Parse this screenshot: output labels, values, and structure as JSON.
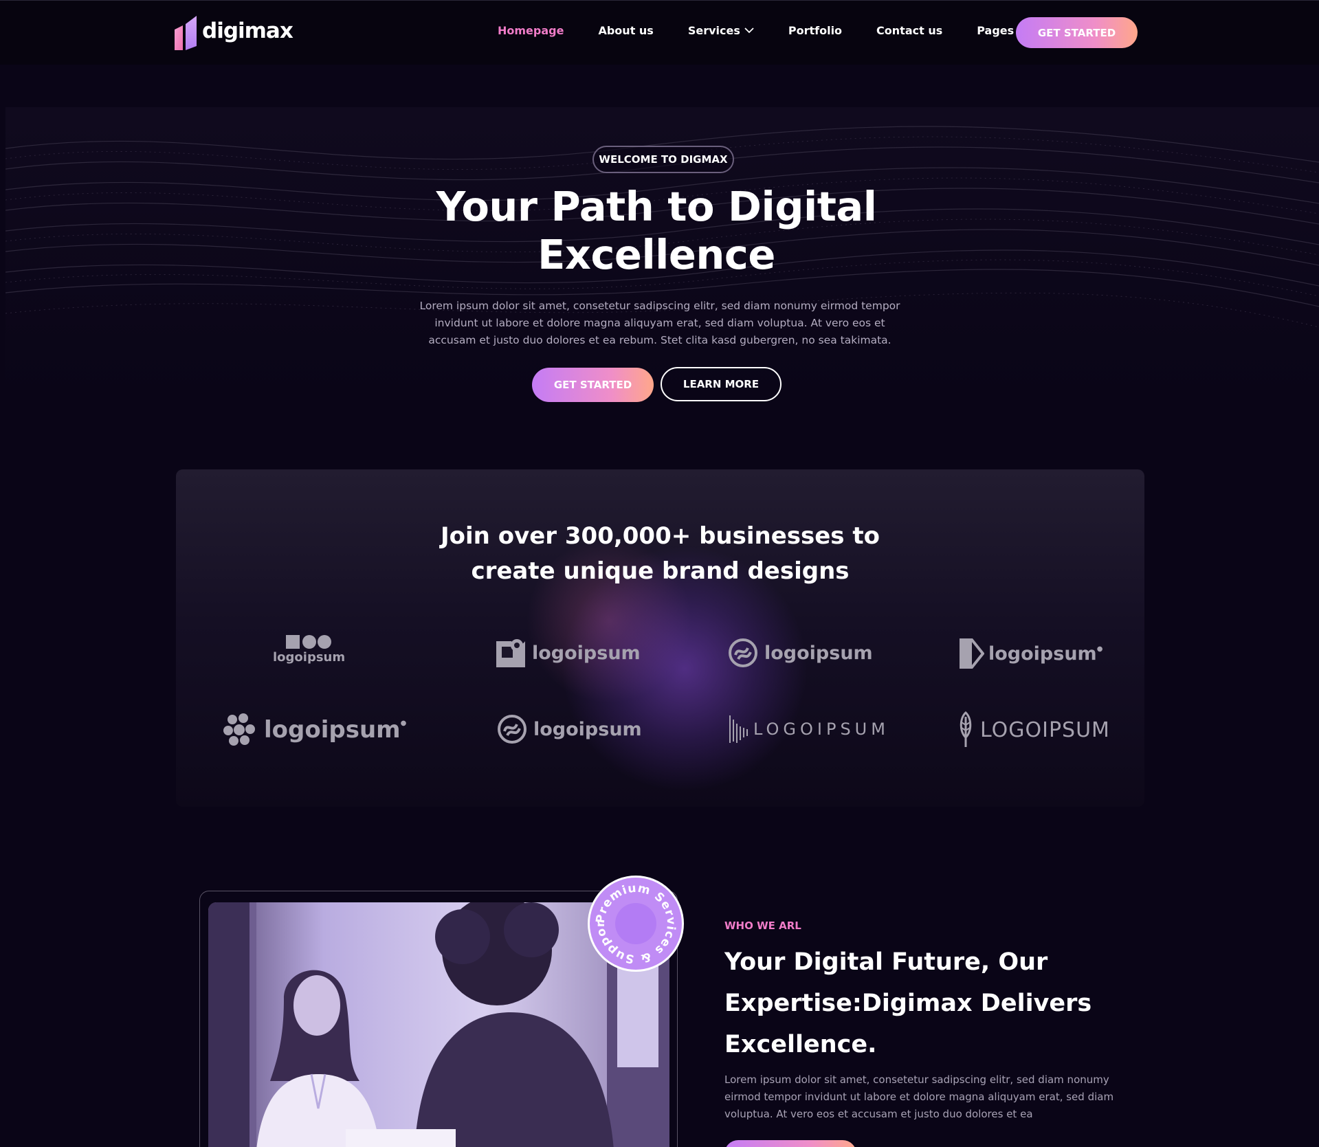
{
  "brand": {
    "name": "digimax"
  },
  "nav": {
    "links": [
      {
        "label": "Homepage",
        "active": true,
        "dropdown": false
      },
      {
        "label": "About us",
        "active": false,
        "dropdown": false
      },
      {
        "label": "Services",
        "active": false,
        "dropdown": true
      },
      {
        "label": "Portfolio",
        "active": false,
        "dropdown": false
      },
      {
        "label": "Contact us",
        "active": false,
        "dropdown": false
      },
      {
        "label": "Pages",
        "active": false,
        "dropdown": true
      }
    ],
    "cta": "GET STARTED"
  },
  "hero": {
    "badge": "WELCOME TO DIGMAX",
    "title_line1": "Your Path to Digital",
    "title_line2": "Excellence",
    "subtitle": "Lorem ipsum dolor sit amet, consetetur sadipscing elitr, sed diam nonumy eirmod tempor invidunt ut labore et dolore magna aliquyam erat, sed diam voluptua. At vero eos et accusam et justo duo dolores et ea rebum. Stet clita kasd gubergren, no sea takimata.",
    "primary_button": "GET STARTED",
    "secondary_button": "LEARN MORE"
  },
  "partners": {
    "title_line1": "Join over 300,000+ businesses to",
    "title_line2": "create unique brand designs",
    "logos": [
      {
        "label": "logoipsum",
        "icon": "shapes-icon"
      },
      {
        "label": "logoipsum",
        "icon": "square-circle-icon"
      },
      {
        "label": "logoipsum",
        "icon": "swirl-circle-icon"
      },
      {
        "label": "logoipsum",
        "icon": "half-hexagon-icon"
      },
      {
        "label": "logoipsum",
        "icon": "bubbles-icon"
      },
      {
        "label": "logoipsum",
        "icon": "swirl-circle-icon"
      },
      {
        "label": "LOGOIPSUM",
        "icon": "soundbars-icon"
      },
      {
        "label": "LOGOIPSUM",
        "icon": "feather-icon"
      }
    ]
  },
  "about": {
    "tag": "WHO WE ARL",
    "title": "Your Digital Future, Our Expertise:Digimax Delivers Excellence.",
    "text": "Lorem ipsum dolor sit amet, consetetur sadipscing elitr, sed diam nonumy eirmod tempor invidunt ut labore et dolore magna aliquyam erat, sed diam voluptua. At vero eos et accusam et justo duo dolores et ea",
    "stamp_text": "Premium Services & Support"
  },
  "colors": {
    "background": "#0a0517",
    "accent_pink": "#f07cc8",
    "gradient_start": "#c47cf5",
    "gradient_end": "#ffa78a"
  }
}
